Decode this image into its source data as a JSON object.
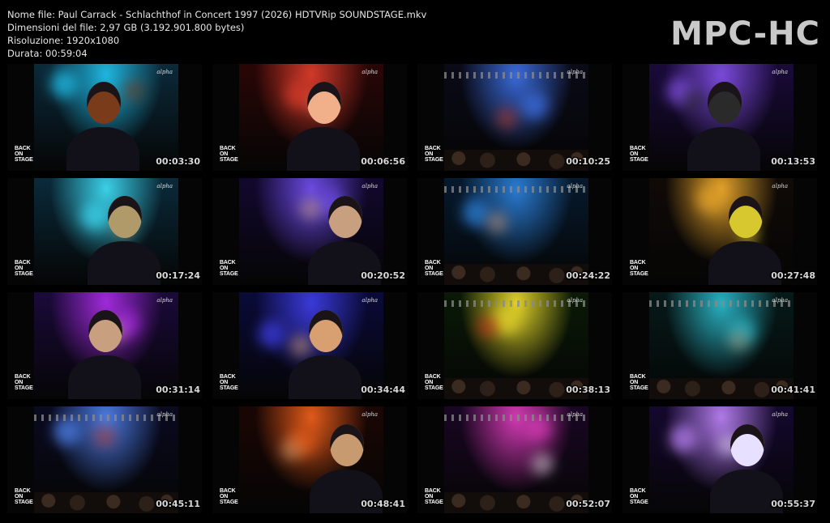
{
  "info": {
    "filename": "Nome file: Paul Carrack - Schlachthof in Concert 1997 (2026) HDTVRip SOUNDSTAGE.mkv",
    "filesize": "Dimensioni del file: 2,97 GB (3.192.901.800 bytes)",
    "resolution": "Risoluzione: 1920x1080",
    "duration": "Durata: 00:59:04"
  },
  "logo": "MPC-HC",
  "overlay": {
    "channel": "alpha",
    "show_logo_lines": [
      "BACK",
      "ON",
      "STAGE"
    ]
  },
  "thumbnails": [
    {
      "time": "00:03:30",
      "palette": {
        "bg": "#0b2a3a",
        "light": "#1fb6e0",
        "accent": "#7a3b1a"
      }
    },
    {
      "time": "00:06:56",
      "palette": {
        "bg": "#2a0606",
        "light": "#d23a2a",
        "accent": "#f2b08a"
      }
    },
    {
      "time": "00:10:25",
      "palette": {
        "bg": "#0a0a18",
        "light": "#3a6ad8",
        "accent": "#c03a2a"
      }
    },
    {
      "time": "00:13:53",
      "palette": {
        "bg": "#1a0a3a",
        "light": "#7a4ad8",
        "accent": "#2a2a2a"
      }
    },
    {
      "time": "00:17:24",
      "palette": {
        "bg": "#0a2a3a",
        "light": "#3ad0e8",
        "accent": "#b09a6a"
      }
    },
    {
      "time": "00:20:52",
      "palette": {
        "bg": "#12082e",
        "light": "#6a4ae0",
        "accent": "#c8a080"
      }
    },
    {
      "time": "00:24:22",
      "palette": {
        "bg": "#061a2e",
        "light": "#2a7ad0",
        "accent": "#c89a80"
      }
    },
    {
      "time": "00:27:48",
      "palette": {
        "bg": "#100a06",
        "light": "#e0a02a",
        "accent": "#d8c830"
      }
    },
    {
      "time": "00:31:14",
      "palette": {
        "bg": "#1a0a3a",
        "light": "#a02ad8",
        "accent": "#c8a080"
      }
    },
    {
      "time": "00:34:44",
      "palette": {
        "bg": "#0a0a3a",
        "light": "#3a3ad8",
        "accent": "#d8a070"
      }
    },
    {
      "time": "00:38:13",
      "palette": {
        "bg": "#0a1a06",
        "light": "#e0d02a",
        "accent": "#d02a1a"
      }
    },
    {
      "time": "00:41:41",
      "palette": {
        "bg": "#061a1a",
        "light": "#2ab0c0",
        "accent": "#9a8a70"
      }
    },
    {
      "time": "00:45:11",
      "palette": {
        "bg": "#0a0a20",
        "light": "#4a7ae0",
        "accent": "#c03a2a"
      }
    },
    {
      "time": "00:48:41",
      "palette": {
        "bg": "#1a0604",
        "light": "#e05a1a",
        "accent": "#c89a70"
      }
    },
    {
      "time": "00:52:07",
      "palette": {
        "bg": "#1a0624",
        "light": "#d03ab0",
        "accent": "#e8e0e8"
      }
    },
    {
      "time": "00:55:37",
      "palette": {
        "bg": "#14082e",
        "light": "#b07ae8",
        "accent": "#e8e0ff"
      }
    }
  ]
}
